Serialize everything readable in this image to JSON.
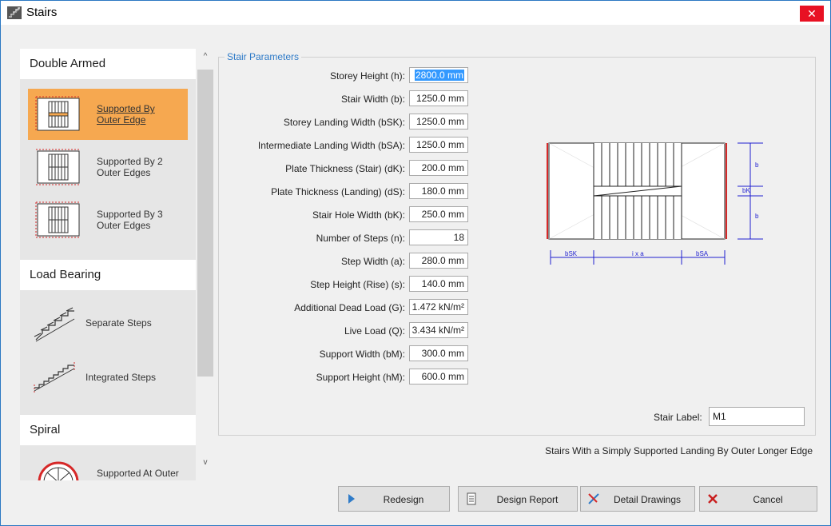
{
  "window": {
    "title": "Stairs",
    "close_symbol": "✕"
  },
  "categories": [
    {
      "heading": "Double Armed",
      "items": [
        {
          "label_line1": "Supported By",
          "label_line2": "Outer Edge",
          "selected": true,
          "icon": "double-armed-outer-edge-icon"
        },
        {
          "label_line1": "Supported By 2",
          "label_line2": "Outer Edges",
          "selected": false,
          "icon": "double-armed-2-edges-icon"
        },
        {
          "label_line1": "Supported By 3",
          "label_line2": "Outer Edges",
          "selected": false,
          "icon": "double-armed-3-edges-icon"
        }
      ]
    },
    {
      "heading": "Load Bearing",
      "items": [
        {
          "label_line1": "Separate Steps",
          "selected": false,
          "icon": "separate-steps-icon"
        },
        {
          "label_line1": "Integrated Steps",
          "selected": false,
          "icon": "integrated-steps-icon"
        }
      ]
    },
    {
      "heading": "Spiral",
      "items": [
        {
          "label_line1": "Supported At Outer",
          "selected": false,
          "icon": "spiral-icon"
        }
      ]
    }
  ],
  "group_title": "Stair Parameters",
  "params": [
    {
      "label": "Storey Height (h):",
      "value": "2800.0 mm",
      "selected": true
    },
    {
      "label": "Stair Width (b):",
      "value": "1250.0 mm"
    },
    {
      "label": "Storey Landing Width (bSK):",
      "value": "1250.0 mm"
    },
    {
      "label": "Intermediate Landing Width (bSA):",
      "value": "1250.0 mm"
    },
    {
      "label": "Plate Thickness (Stair) (dK):",
      "value": "200.0 mm"
    },
    {
      "label": "Plate Thickness (Landing) (dS):",
      "value": "180.0 mm"
    },
    {
      "label": "Stair Hole Width (bK):",
      "value": "250.0 mm"
    },
    {
      "label": "Number of Steps (n):",
      "value": "18"
    },
    {
      "label": "Step Width (a):",
      "value": "280.0 mm"
    },
    {
      "label": "Step Height (Rise) (s):",
      "value": "140.0 mm"
    },
    {
      "label": "Additional Dead Load (G):",
      "value": "1.472 kN/m²"
    },
    {
      "label": "Live Load (Q):",
      "value": "3.434 kN/m²"
    },
    {
      "label": "Support Width (bM):",
      "value": "300.0 mm"
    },
    {
      "label": "Support Height (hM):",
      "value": "600.0 mm"
    }
  ],
  "diagram": {
    "dim_b_top": "b",
    "dim_bk": "bK",
    "dim_b_bottom": "b",
    "dim_bsk": "bSK",
    "dim_ixa": "i x a",
    "dim_bsa": "bSA"
  },
  "stair_label": {
    "label": "Stair Label:",
    "value": "M1"
  },
  "description": "Stairs With a Simply Supported Landing By Outer Longer Edge",
  "buttons": {
    "redesign": "Redesign",
    "design_report": "Design Report",
    "detail_drawings": "Detail Drawings",
    "cancel": "Cancel"
  },
  "colors": {
    "selected_item": "#f6a850",
    "accent_blue": "#2f7bc8",
    "support_red": "#d62828",
    "close_red": "#e81123"
  }
}
